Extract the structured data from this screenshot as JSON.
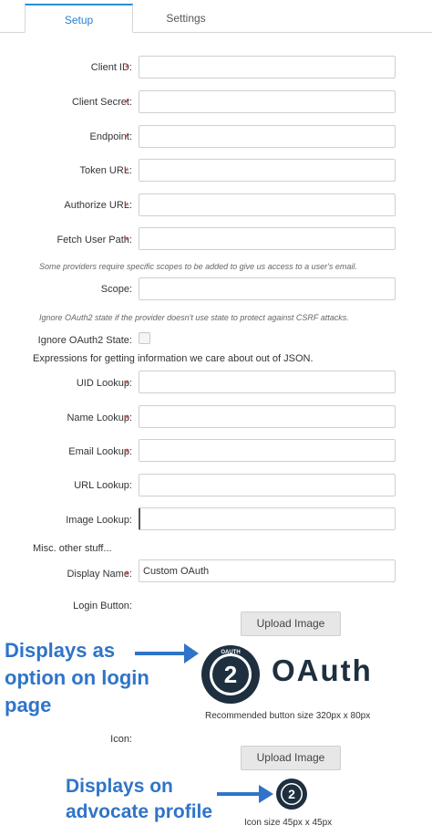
{
  "tabs": {
    "setup": "Setup",
    "settings": "Settings"
  },
  "fields": {
    "client_id": {
      "label": "Client ID:",
      "value": ""
    },
    "client_secret": {
      "label": "Client Secret:",
      "value": ""
    },
    "endpoint": {
      "label": "Endpoint:",
      "value": ""
    },
    "token_url": {
      "label": "Token URL:",
      "value": ""
    },
    "authorize_url": {
      "label": "Authorize URL:",
      "value": ""
    },
    "fetch_user_path": {
      "label": "Fetch User Path:",
      "value": ""
    },
    "scope_hint": "Some providers require specific scopes to be added to give us access to a user's email.",
    "scope": {
      "label": "Scope:",
      "value": ""
    },
    "state_hint": "Ignore OAuth2 state if the provider doesn't use state to protect against CSRF attacks.",
    "ignore_state": {
      "label": "Ignore OAuth2 State:",
      "checked": false
    },
    "expressions_heading": "Expressions for getting information we care about out of JSON.",
    "uid_lookup": {
      "label": "UID Lookup:",
      "value": ""
    },
    "name_lookup": {
      "label": "Name Lookup:",
      "value": ""
    },
    "email_lookup": {
      "label": "Email Lookup:",
      "value": ""
    },
    "url_lookup": {
      "label": "URL Lookup:",
      "value": ""
    },
    "image_lookup": {
      "label": "Image Lookup:",
      "value": ""
    },
    "misc_heading": "Misc. other stuff...",
    "display_name": {
      "label": "Display Name:",
      "value": "Custom OAuth"
    }
  },
  "required_marker": "*",
  "login_button": {
    "label": "Login Button:",
    "upload_label": "Upload Image",
    "logo_word": "OAuth",
    "logo_badge": "2",
    "logo_ring_text": "OAUTH",
    "caption": "Recommended button size 320px x 80px"
  },
  "icon": {
    "label": "Icon:",
    "upload_label": "Upload Image",
    "badge": "2",
    "caption": "Icon size 45px x 45px"
  },
  "annotations": {
    "login": [
      "Displays as",
      "option on login",
      "page"
    ],
    "profile": [
      "Displays on",
      "advocate profile"
    ]
  },
  "colors": {
    "accent": "#2b8fd6",
    "required": "#d43f3a",
    "annotation": "#2f74c9",
    "logo_dark": "#1e2f3f"
  }
}
